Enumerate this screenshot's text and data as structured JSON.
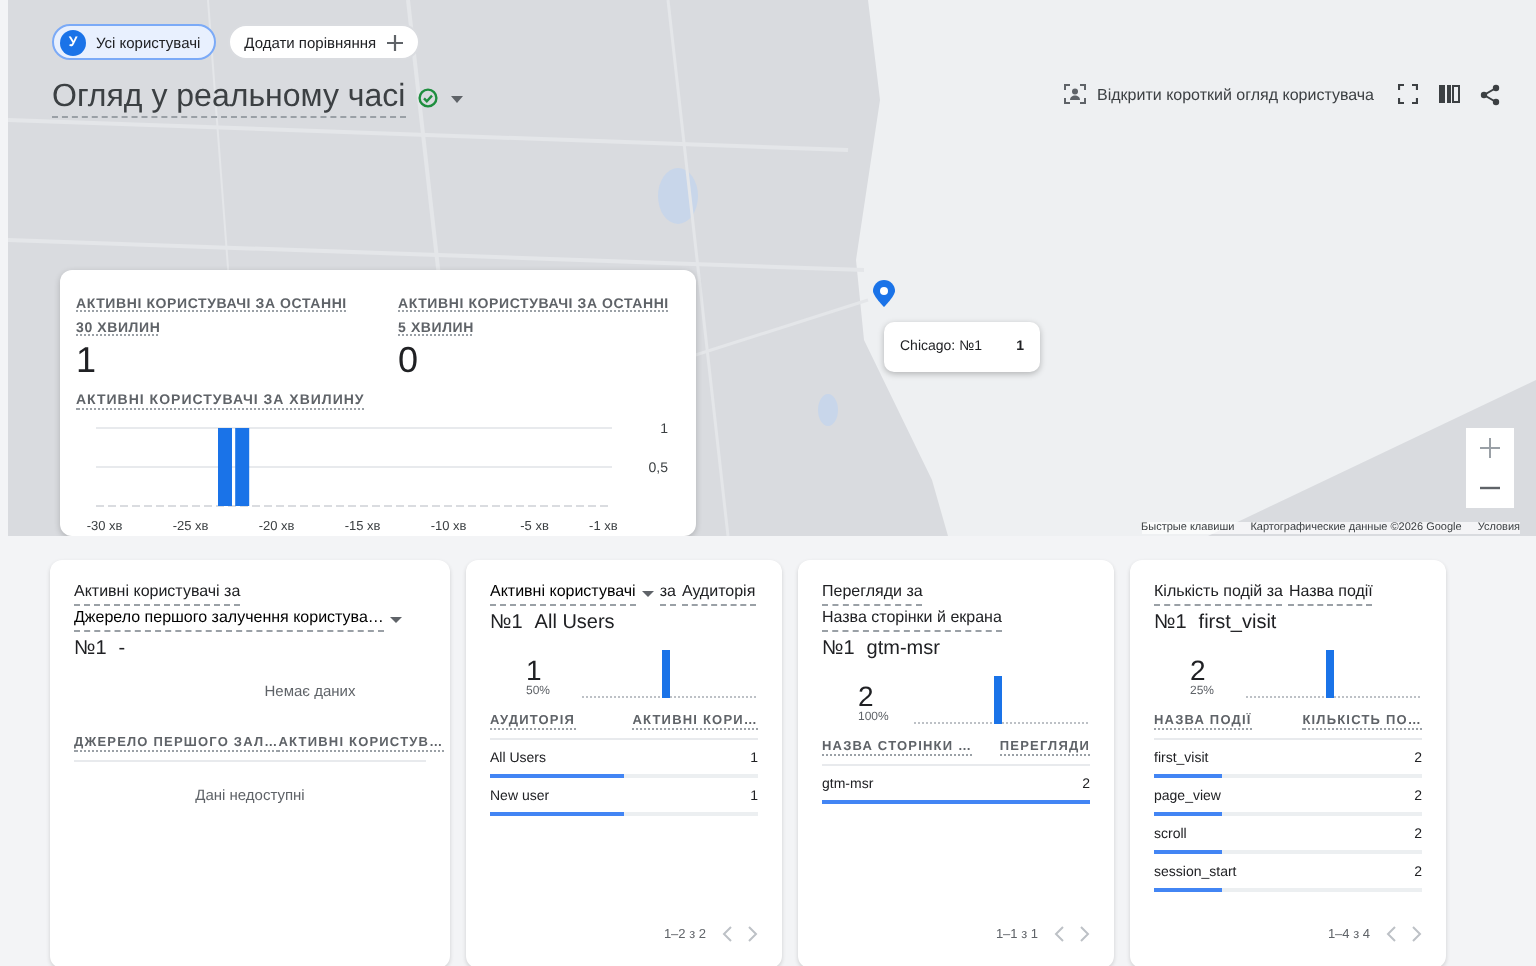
{
  "segment": {
    "badge": "У",
    "label": "Усі користувачі"
  },
  "add_comparison": "Додати порівняння",
  "title": "Огляд у реальному часі",
  "actions": {
    "user_snapshot": "Відкрити короткий огляд користувача"
  },
  "map": {
    "tooltip": {
      "label": "Chicago: №1",
      "value": "1"
    },
    "attribution": [
      "Быстрые клавиши",
      "Картографические данные ©2026 Google",
      "Условия"
    ]
  },
  "summary": {
    "metrics": [
      {
        "label": "АКТИВНІ КОРИСТУВАЧІ ЗА ОСТАННІ 30 ХВИЛИН",
        "value": "1"
      },
      {
        "label": "АКТИВНІ КОРИСТУВАЧІ ЗА ОСТАННІ 5 ХВИЛИН",
        "value": "0"
      }
    ],
    "chart_title": "АКТИВНІ КОРИСТУВАЧІ ЗА ХВИЛИНУ",
    "chart_data": {
      "type": "bar",
      "x": [
        -30,
        -29,
        -28,
        -27,
        -26,
        -25,
        -24,
        -23,
        -22,
        -21,
        -20,
        -19,
        -18,
        -17,
        -16,
        -15,
        -14,
        -13,
        -12,
        -11,
        -10,
        -9,
        -8,
        -7,
        -6,
        -5,
        -4,
        -3,
        -2,
        -1
      ],
      "values": [
        0,
        0,
        0,
        0,
        0,
        0,
        0,
        1,
        1,
        0,
        0,
        0,
        0,
        0,
        0,
        0,
        0,
        0,
        0,
        0,
        0,
        0,
        0,
        0,
        0,
        0,
        0,
        0,
        0,
        0
      ],
      "ylim": [
        0,
        1
      ],
      "xlim": [
        -30.5,
        -0.5
      ],
      "yticks": [
        {
          "value": 0.5,
          "label": "0,5"
        },
        {
          "value": 1,
          "label": "1"
        }
      ],
      "xticks": [
        {
          "value": -30,
          "label": "-30 хв"
        },
        {
          "value": -25,
          "label": "-25 хв"
        },
        {
          "value": -20,
          "label": "-20 хв"
        },
        {
          "value": -15,
          "label": "-15 хв"
        },
        {
          "value": -10,
          "label": "-10 хв"
        },
        {
          "value": -5,
          "label": "-5 хв"
        },
        {
          "value": -1,
          "label": "-1 хв"
        }
      ]
    }
  },
  "cards": [
    {
      "kind": "empty",
      "title_lines": [
        [
          {
            "text": "Активні користувачі за",
            "dropdown": false
          }
        ],
        [
          {
            "text": "Джерело першого залучення користува…",
            "dropdown": true
          }
        ]
      ],
      "top_rank": "№1",
      "top_name": "-",
      "no_data": "Немає даних",
      "columns": [
        "ДЖЕРЕЛО ПЕРШОГО ЗАЛ…",
        "АКТИВНІ КОРИСТУВ…"
      ],
      "empty_message": "Дані недоступні"
    },
    {
      "kind": "data",
      "title_lines": [
        [
          {
            "text": "Активні користувачі",
            "dropdown": true
          },
          {
            "text": "за",
            "dropdown": false
          },
          {
            "text": "Аудиторія",
            "dropdown": false
          }
        ]
      ],
      "top_rank": "№1",
      "top_name": "All Users",
      "count": "1",
      "share": "50%",
      "columns": [
        "АУДИТОРІЯ",
        "АКТИВНІ КОРИ…"
      ],
      "rows": [
        {
          "label": "All Users",
          "value": "1",
          "level": 0.5
        },
        {
          "label": "New user",
          "value": "1",
          "level": 0.5
        }
      ],
      "pagination": "1–2 з 2"
    },
    {
      "kind": "data",
      "title_lines": [
        [
          {
            "text": "Перегляди за",
            "dropdown": false
          }
        ],
        [
          {
            "text": "Назва сторінки й екрана",
            "dropdown": false
          }
        ]
      ],
      "top_rank": "№1",
      "top_name": "gtm-msr",
      "count": "2",
      "share": "100%",
      "columns": [
        "НАЗВА СТОРІНКИ …",
        "ПЕРЕГЛЯДИ"
      ],
      "rows": [
        {
          "label": "gtm-msr",
          "value": "2",
          "level": 1
        }
      ],
      "pagination": "1–1 з 1"
    },
    {
      "kind": "data",
      "title_lines": [
        [
          {
            "text": "Кількість подій за",
            "dropdown": false
          },
          {
            "text": "Назва події",
            "dropdown": false
          }
        ]
      ],
      "top_rank": "№1",
      "top_name": "first_visit",
      "count": "2",
      "share": "25%",
      "columns": [
        "НАЗВА ПОДІЇ",
        "КІЛЬКІСТЬ ПО…"
      ],
      "rows": [
        {
          "label": "first_visit",
          "value": "2",
          "level": 0.25
        },
        {
          "label": "page_view",
          "value": "2",
          "level": 0.25
        },
        {
          "label": "scroll",
          "value": "2",
          "level": 0.25
        },
        {
          "label": "session_start",
          "value": "2",
          "level": 0.25
        }
      ],
      "pagination": "1–4 з 4"
    }
  ]
}
